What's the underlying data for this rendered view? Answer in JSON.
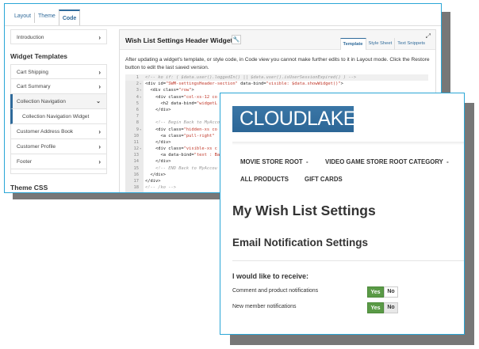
{
  "back_window": {
    "tabs": [
      {
        "label": "Layout",
        "active": false
      },
      {
        "label": "Theme",
        "active": false
      },
      {
        "label": "Code",
        "active": true
      }
    ],
    "sidebar": {
      "intro": "Introduction",
      "section_title": "Widget Templates",
      "items": [
        {
          "label": "Cart Shipping"
        },
        {
          "label": "Cart Summary"
        },
        {
          "label": "Collection Navigation",
          "expanded": true
        },
        {
          "label": "Collection Navigation Widget",
          "sub": true
        },
        {
          "label": "Customer Address Book"
        },
        {
          "label": "Customer Profile"
        },
        {
          "label": "Footer"
        }
      ],
      "section_title_2": "Theme CSS"
    },
    "panel": {
      "title": "Wish List Settings Header Widget",
      "tabs": [
        {
          "label": "Template",
          "active": true
        },
        {
          "label": "Style Sheet"
        },
        {
          "label": "Text Snippets"
        }
      ],
      "description": "After updating a widget's template, or style code, in Code view you cannot make further edits to it in Layout mode. Click the Restore button to edit the last saved version.",
      "code_lines": [
        "<!-- ko if: ( $data.user().loggedIn() || $data.user().isUserSessionExpired() ) -->",
        "<div id=\"SWM-settingsHeader-section\" data-bind=\"visible: $data.showWidget()\">",
        "  <div class=\"row\">",
        "    <div class=\"col-xs-12 co",
        "      <h2 data-bind=\"widgetL",
        "    </div>",
        "",
        "    <!-- Begin Back to MyAccou",
        "    <div class=\"hidden-xs co",
        "      <a class=\"pull-right\"",
        "    </div>",
        "    <div class=\"visible-xs c",
        "      <a data-bind=\"text : Ba",
        "    </div>",
        "    <!-- END Back to MyAccou",
        "  </div>",
        "</div>",
        "<!-- /ko -->"
      ]
    }
  },
  "front_window": {
    "logo": "CLOUDLAKE",
    "nav": [
      "MOVIE STORE ROOT",
      "VIDEO GAME STORE ROOT CATEGORY",
      "ALL PRODUCTS",
      "GIFT CARDS"
    ],
    "page_title": "My Wish List Settings",
    "section_title": "Email Notification Settings",
    "receive_label": "I would like to receive:",
    "settings": [
      {
        "label": "Comment and product notifications",
        "yes": "Yes",
        "no": "No",
        "value": "Yes"
      },
      {
        "label": "New member notifications",
        "yes": "Yes",
        "no": "No",
        "value": "Yes"
      }
    ]
  },
  "colors": {
    "border": "#2aa6d6",
    "brand": "#2f6a9a",
    "toggle_on": "#5a9a46",
    "shadow": "#777777"
  }
}
